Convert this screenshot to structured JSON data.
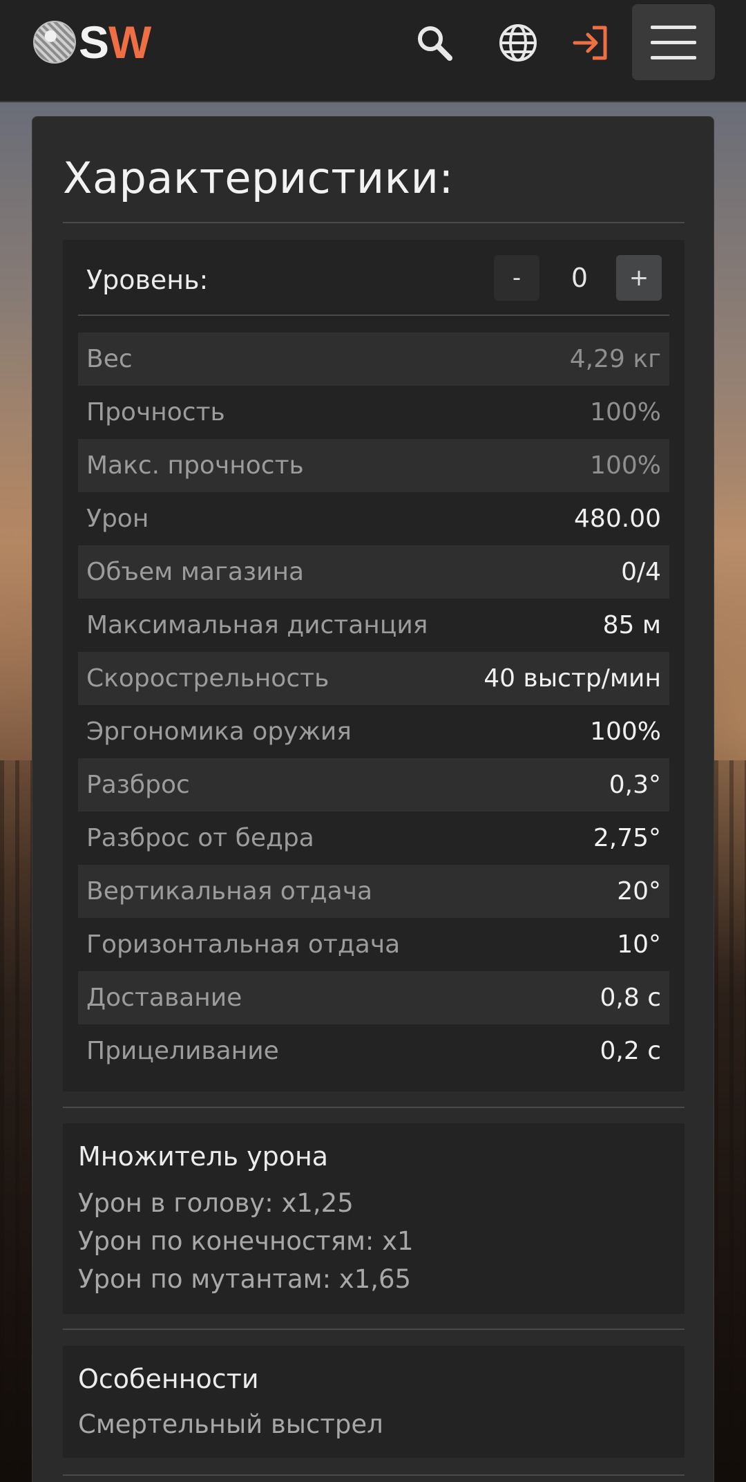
{
  "navbar": {
    "logo_s": "S",
    "logo_w": "W",
    "icons": [
      "search-icon",
      "globe-icon",
      "login-icon",
      "menu-icon"
    ],
    "accent_color": "#ef6f45"
  },
  "card": {
    "title": "Характеристики:",
    "level": {
      "label": "Уровень:",
      "minus": "-",
      "value": "0",
      "plus": "+"
    },
    "stats": [
      {
        "label": "Вес",
        "value": "4,29 кг",
        "dim": true
      },
      {
        "label": "Прочность",
        "value": "100%",
        "dim": true
      },
      {
        "label": "Макс. прочность",
        "value": "100%",
        "dim": true
      },
      {
        "label": "Урон",
        "value": "480.00",
        "dim": false
      },
      {
        "label": "Объем магазина",
        "value": "0/4",
        "dim": false
      },
      {
        "label": "Максимальная дистанция",
        "value": "85 м",
        "dim": false
      },
      {
        "label": "Скорострельность",
        "value": "40 выстр/мин",
        "dim": false
      },
      {
        "label": "Эргономика оружия",
        "value": "100%",
        "dim": false
      },
      {
        "label": "Разброс",
        "value": "0,3°",
        "dim": false
      },
      {
        "label": "Разброс от бедра",
        "value": "2,75°",
        "dim": false
      },
      {
        "label": "Вертикальная отдача",
        "value": "20°",
        "dim": false
      },
      {
        "label": "Горизонтальная отдача",
        "value": "10°",
        "dim": false
      },
      {
        "label": "Доставание",
        "value": "0,8 с",
        "dim": false
      },
      {
        "label": "Прицеливание",
        "value": "0,2 с",
        "dim": false
      }
    ],
    "damage_multiplier": {
      "title": "Множитель урона",
      "lines": [
        "Урон в голову: x1,25",
        "Урон по конечностям: x1",
        "Урон по мутантам: x1,65"
      ]
    },
    "features": {
      "title": "Особенности",
      "lines": [
        "Смертельный выстрел"
      ]
    }
  }
}
